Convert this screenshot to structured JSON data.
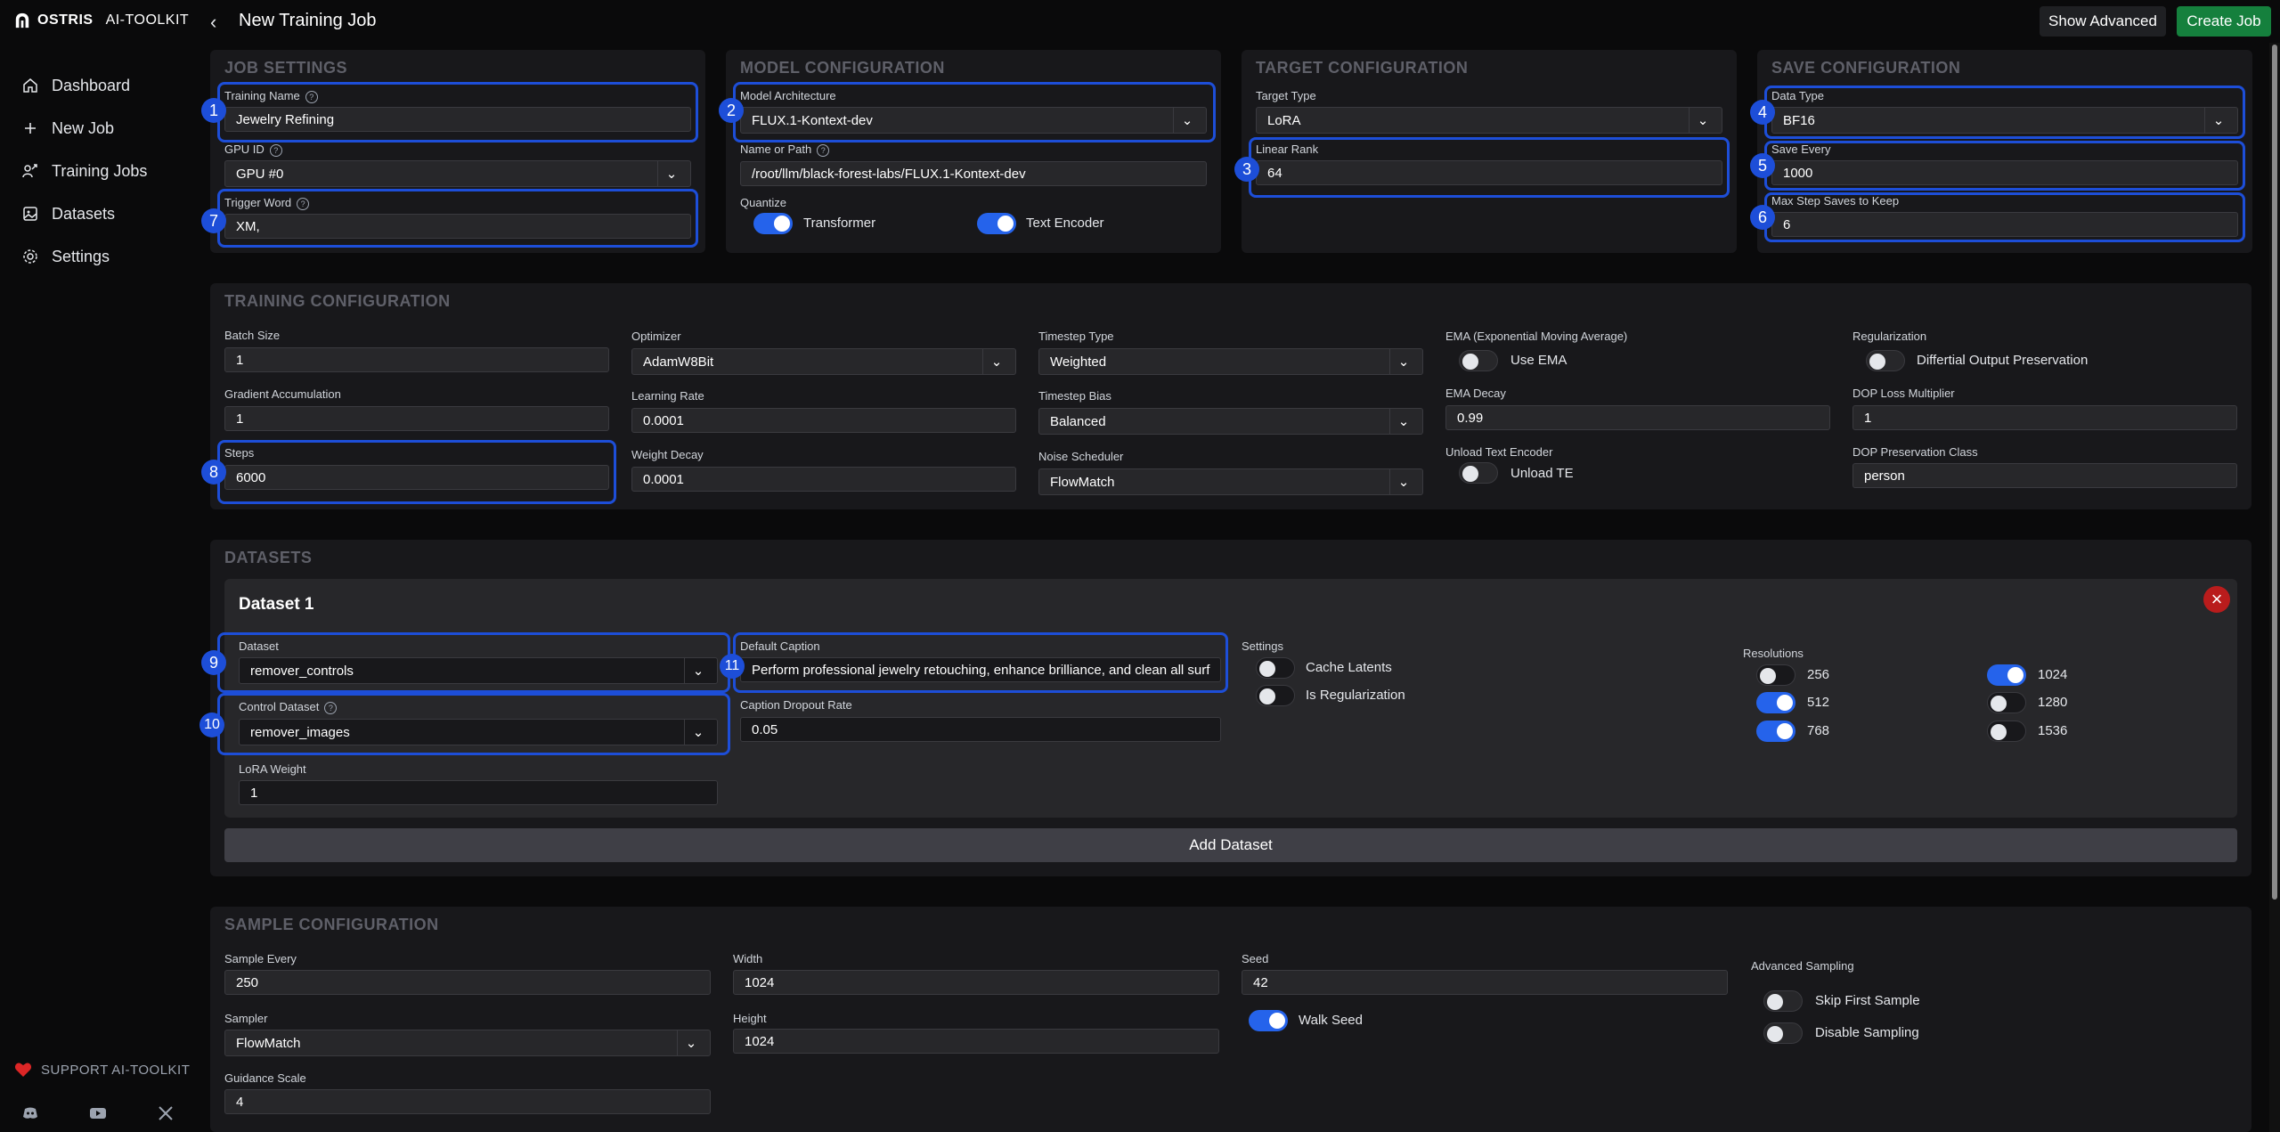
{
  "app": {
    "brand_bold": "OSTRIS",
    "brand_light": "AI-TOOLKIT",
    "page_title": "New Training Job"
  },
  "sidebar": {
    "items": [
      {
        "label": "Dashboard",
        "icon": "home-icon"
      },
      {
        "label": "New Job",
        "icon": "plus-icon"
      },
      {
        "label": "Training Jobs",
        "icon": "training-icon"
      },
      {
        "label": "Datasets",
        "icon": "image-icon"
      },
      {
        "label": "Settings",
        "icon": "gear-icon"
      }
    ],
    "support": "SUPPORT AI-TOOLKIT"
  },
  "header": {
    "show_advanced": "Show Advanced",
    "create_job": "Create Job"
  },
  "job_settings": {
    "title": "JOB SETTINGS",
    "training_name_label": "Training Name",
    "training_name": "Jewelry Refining",
    "gpu_label": "GPU ID",
    "gpu": "GPU #0",
    "trigger_label": "Trigger Word",
    "trigger": "XM,"
  },
  "model_config": {
    "title": "MODEL CONFIGURATION",
    "arch_label": "Model Architecture",
    "arch": "FLUX.1-Kontext-dev",
    "path_label": "Name or Path",
    "path": "/root/llm/black-forest-labs/FLUX.1-Kontext-dev",
    "quantize_label": "Quantize",
    "transformer": "Transformer",
    "text_encoder": "Text Encoder"
  },
  "target_config": {
    "title": "TARGET CONFIGURATION",
    "type_label": "Target Type",
    "type": "LoRA",
    "rank_label": "Linear Rank",
    "rank": "64"
  },
  "save_config": {
    "title": "SAVE CONFIGURATION",
    "dtype_label": "Data Type",
    "dtype": "BF16",
    "every_label": "Save Every",
    "every": "1000",
    "max_label": "Max Step Saves to Keep",
    "max": "6"
  },
  "training_config": {
    "title": "TRAINING CONFIGURATION",
    "batch_label": "Batch Size",
    "batch": "1",
    "grad_label": "Gradient Accumulation",
    "grad": "1",
    "steps_label": "Steps",
    "steps": "6000",
    "optimizer_label": "Optimizer",
    "optimizer": "AdamW8Bit",
    "lr_label": "Learning Rate",
    "lr": "0.0001",
    "wd_label": "Weight Decay",
    "wd": "0.0001",
    "ts_type_label": "Timestep Type",
    "ts_type": "Weighted",
    "ts_bias_label": "Timestep Bias",
    "ts_bias": "Balanced",
    "noise_label": "Noise Scheduler",
    "noise": "FlowMatch",
    "ema_label": "EMA (Exponential Moving Average)",
    "use_ema": "Use EMA",
    "ema_decay_label": "EMA Decay",
    "ema_decay": "0.99",
    "unload_label": "Unload Text Encoder",
    "unload": "Unload TE",
    "reg_label": "Regularization",
    "dop": "Differtial Output Preservation",
    "dop_mult_label": "DOP Loss Multiplier",
    "dop_mult": "1",
    "dop_class_label": "DOP Preservation Class",
    "dop_class": "person"
  },
  "datasets": {
    "title": "DATASETS",
    "ds_title": "Dataset 1",
    "dataset_label": "Dataset",
    "dataset": "remover_controls",
    "control_label": "Control Dataset",
    "control": "remover_images",
    "lora_label": "LoRA Weight",
    "lora": "1",
    "caption_label": "Default Caption",
    "caption": "Perform professional jewelry retouching, enhance brilliance, and clean all surf",
    "dropout_label": "Caption Dropout Rate",
    "dropout": "0.05",
    "settings_label": "Settings",
    "cache": "Cache Latents",
    "is_reg": "Is Regularization",
    "res_label": "Resolutions",
    "res": [
      "256",
      "512",
      "768",
      "1024",
      "1280",
      "1536"
    ],
    "add": "Add Dataset"
  },
  "sample_config": {
    "title": "SAMPLE CONFIGURATION",
    "every_label": "Sample Every",
    "every": "250",
    "sampler_label": "Sampler",
    "sampler": "FlowMatch",
    "guidance_label": "Guidance Scale",
    "guidance": "4",
    "width_label": "Width",
    "width": "1024",
    "height_label": "Height",
    "height": "1024",
    "seed_label": "Seed",
    "seed": "42",
    "walk_seed": "Walk Seed",
    "adv_label": "Advanced Sampling",
    "skip_first": "Skip First Sample",
    "disable": "Disable Sampling"
  },
  "markers": [
    "1",
    "2",
    "3",
    "4",
    "5",
    "6",
    "7",
    "8",
    "9",
    "10",
    "11"
  ]
}
